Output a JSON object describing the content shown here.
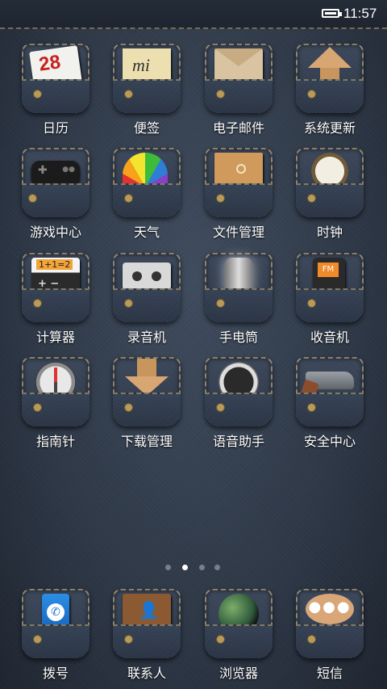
{
  "status_bar": {
    "time": "11:57"
  },
  "home_apps": [
    {
      "label": "日历",
      "icon": "calendar-icon",
      "calendar_day": "28"
    },
    {
      "label": "便签",
      "icon": "notes-icon",
      "note_text": "mi"
    },
    {
      "label": "电子邮件",
      "icon": "email-icon"
    },
    {
      "label": "系统更新",
      "icon": "system-update-icon"
    },
    {
      "label": "游戏中心",
      "icon": "game-controller-icon"
    },
    {
      "label": "天气",
      "icon": "weather-umbrella-icon"
    },
    {
      "label": "文件管理",
      "icon": "file-folder-icon"
    },
    {
      "label": "时钟",
      "icon": "pocket-watch-icon"
    },
    {
      "label": "计算器",
      "icon": "calculator-icon",
      "display": "1+1=2"
    },
    {
      "label": "录音机",
      "icon": "cassette-recorder-icon"
    },
    {
      "label": "手电筒",
      "icon": "flashlight-icon"
    },
    {
      "label": "收音机",
      "icon": "fm-radio-icon",
      "display": "FM"
    },
    {
      "label": "指南针",
      "icon": "compass-icon"
    },
    {
      "label": "下载管理",
      "icon": "download-arrow-icon"
    },
    {
      "label": "语音助手",
      "icon": "microphone-icon"
    },
    {
      "label": "安全中心",
      "icon": "revolver-icon"
    }
  ],
  "page_indicator": {
    "pages": 4,
    "current": 2
  },
  "dock_apps": [
    {
      "label": "拨号",
      "icon": "phone-dial-icon"
    },
    {
      "label": "联系人",
      "icon": "contacts-book-icon"
    },
    {
      "label": "浏览器",
      "icon": "globe-browser-icon"
    },
    {
      "label": "短信",
      "icon": "message-bubble-icon"
    }
  ]
}
